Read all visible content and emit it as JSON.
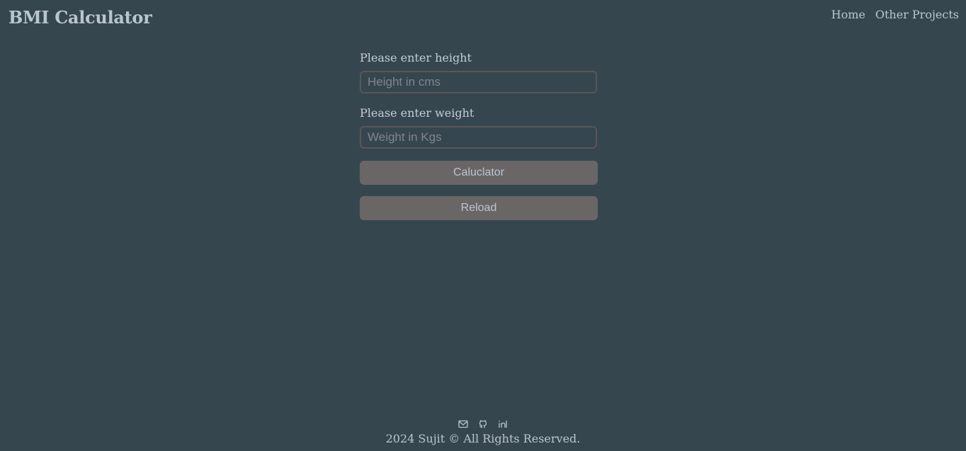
{
  "header": {
    "title": "BMI Calculator",
    "nav": [
      {
        "label": "Home"
      },
      {
        "label": "Other Projects"
      }
    ]
  },
  "form": {
    "height_label": "Please enter height",
    "height_placeholder": "Height in cms",
    "weight_label": "Please enter weight",
    "weight_placeholder": "Weight in Kgs",
    "calculate_label": "Caluclator",
    "reload_label": "Reload"
  },
  "footer": {
    "icons": [
      "mail-icon",
      "github-icon",
      "linkedin-icon"
    ],
    "copyright": "2024 Sujit © All Rights Reserved."
  },
  "colors": {
    "background": "#36464f",
    "text": "#b9c6cf",
    "button": "#6a6666",
    "input_border": "#5c5555"
  }
}
